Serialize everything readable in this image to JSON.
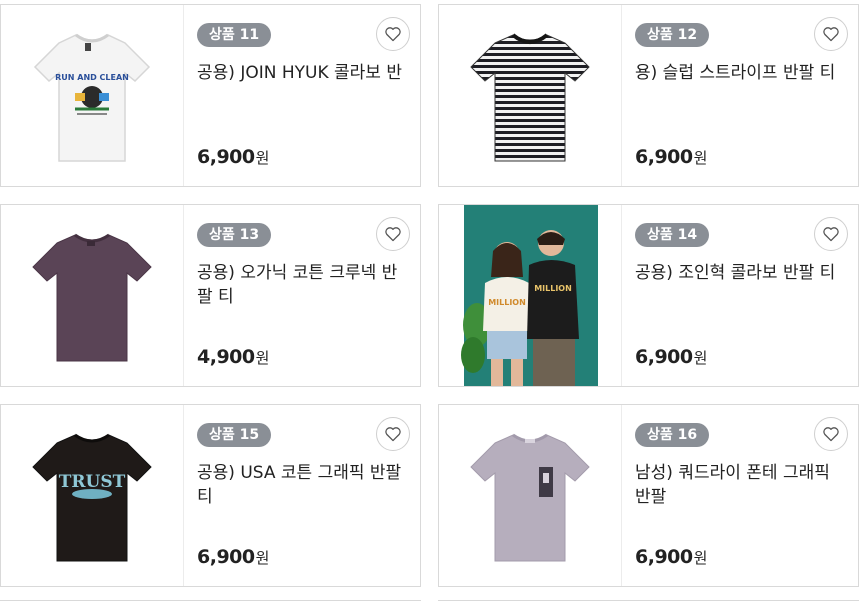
{
  "products": [
    {
      "badge": "상품 11",
      "name": "공용) JOIN HYUK 콜라보 반",
      "price": "6,900",
      "currency": "원",
      "image": "white-tshirt-run-and-clean-print"
    },
    {
      "badge": "상품 12",
      "name": "용) 슬럽 스트라이프 반팔 티",
      "price": "6,900",
      "currency": "원",
      "image": "black-white-striped-tshirt"
    },
    {
      "badge": "상품 13",
      "name": "공용) 오가닉 코튼 크루넥 반팔 티",
      "price": "4,900",
      "currency": "원",
      "image": "purple-crewneck-tshirt"
    },
    {
      "badge": "상품 14",
      "name": "공용) 조인혁 콜라보 반팔 티",
      "price": "6,900",
      "currency": "원",
      "image": "couple-model-photo"
    },
    {
      "badge": "상품 15",
      "name": "공용) USA 코튼 그래픽 반팔티",
      "price": "6,900",
      "currency": "원",
      "image": "black-tshirt-trust-print"
    },
    {
      "badge": "상품 16",
      "name": "남성) 쿼드라이 폰테 그래픽 반팔",
      "price": "6,900",
      "currency": "원",
      "image": "lavender-graphic-tshirt"
    }
  ],
  "colors": {
    "badge_bg": "#8a8f96",
    "border": "#d9d9d9",
    "text": "#222222"
  },
  "icons": {
    "wishlist": "heart-outline-icon"
  }
}
